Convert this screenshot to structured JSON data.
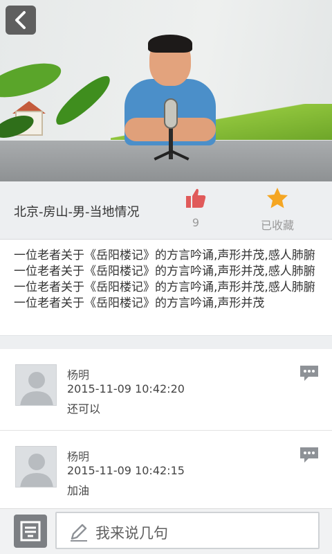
{
  "header": {
    "back_icon": "chevron-left-icon"
  },
  "video": {
    "thumbnail": "man-speaking-at-microphone"
  },
  "info": {
    "title": "北京-房山-男-当地情况",
    "like_icon": "thumbs-up-icon",
    "like_count": "9",
    "favorite_icon": "star-icon",
    "favorite_label": "已收藏",
    "like_color": "#e05a5a",
    "favorite_color": "#f5a623"
  },
  "description": "一位老者关于《岳阳楼记》的方言吟诵,声形并茂,感人肺腑一位老者关于《岳阳楼记》的方言吟诵,声形并茂,感人肺腑一位老者关于《岳阳楼记》的方言吟诵,声形并茂,感人肺腑一位老者关于《岳阳楼记》的方言吟诵,声形并茂",
  "comments": [
    {
      "name": "杨明",
      "time": "2015-11-09 10:42:20",
      "text": "还可以"
    },
    {
      "name": "杨明",
      "time": "2015-11-09 10:42:15",
      "text": "加油"
    }
  ],
  "input": {
    "placeholder": "我来说几句",
    "keyboard_icon": "keyboard-icon",
    "pencil_icon": "pencil-icon"
  }
}
